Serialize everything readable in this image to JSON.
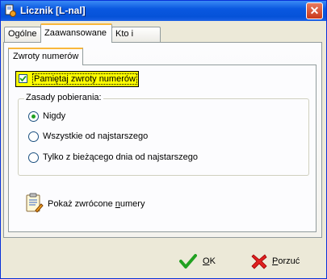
{
  "window": {
    "title": "Licznik [L-nal]"
  },
  "tabs": [
    {
      "label": "Ogólne"
    },
    {
      "label": "Zaawansowane"
    },
    {
      "label": "Kto i Kiedy"
    }
  ],
  "subtab": {
    "label": "Zwroty numerów"
  },
  "remember_checkbox": {
    "label": "Pamiętaj zwroty numerów",
    "checked": true
  },
  "group": {
    "title": "Zasady pobierania:",
    "options": [
      {
        "label": "Nigdy",
        "selected": true
      },
      {
        "label": "Wszystkie od najstarszego",
        "selected": false
      },
      {
        "label": "Tylko z bieżącego dnia od najstarszego",
        "selected": false
      }
    ]
  },
  "show_returned": {
    "pre": "Pokaż zwrócone ",
    "accel": "n",
    "post": "umery"
  },
  "ok": {
    "accel": "O",
    "rest": "K"
  },
  "cancel": {
    "accel": "P",
    "rest": "orzuć"
  },
  "colors": {
    "highlight": "#FFFF00",
    "radio_dot": "#21A121",
    "titlebar": "#0A58E0"
  }
}
